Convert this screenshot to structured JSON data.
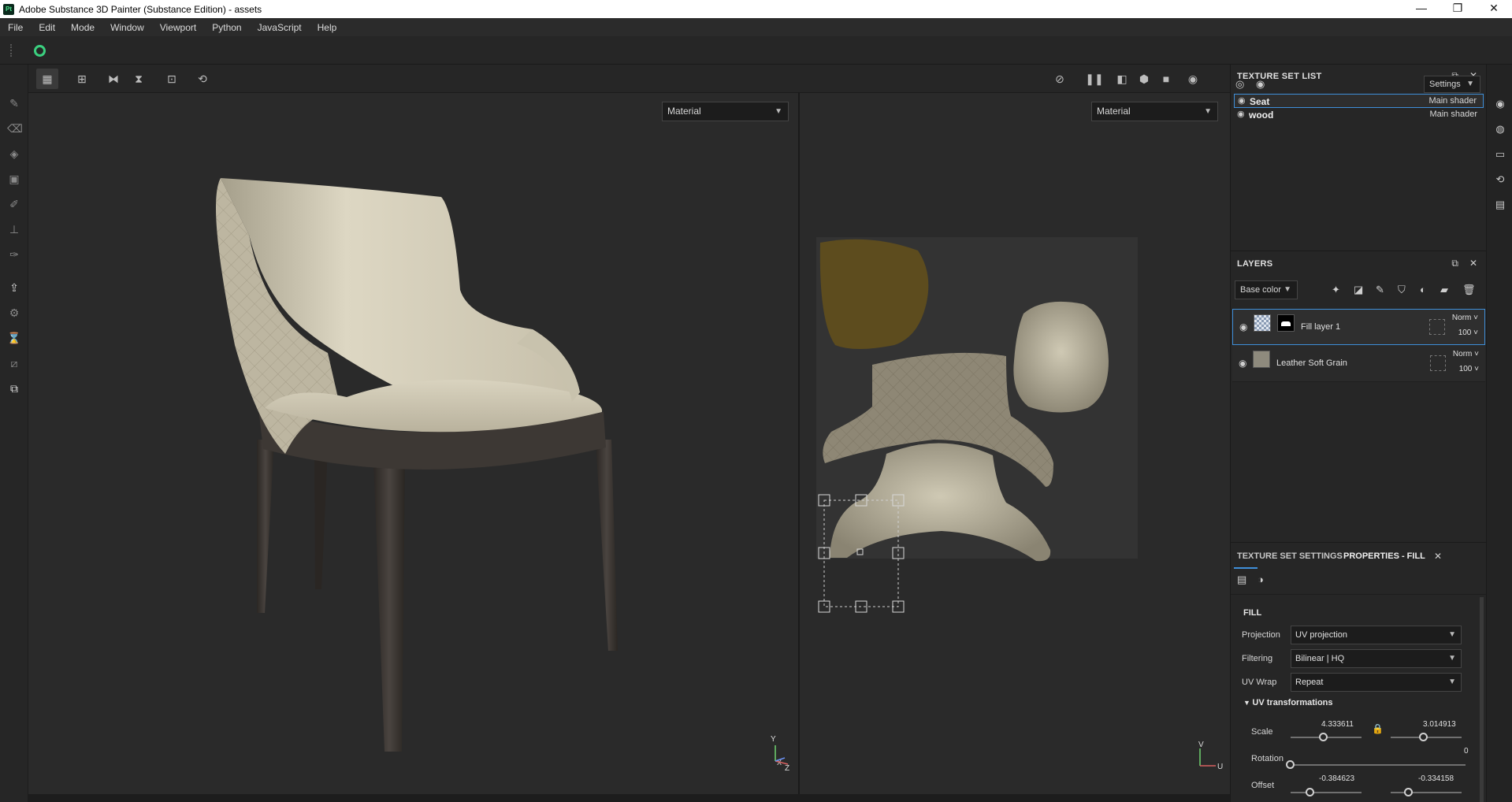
{
  "window": {
    "app_icon": "Pt",
    "title": "Adobe Substance 3D Painter (Substance Edition) - assets",
    "controls": [
      "—",
      "❐",
      "✕"
    ]
  },
  "menu": [
    "File",
    "Edit",
    "Mode",
    "Window",
    "Viewport",
    "Python",
    "JavaScript",
    "Help"
  ],
  "viewports": {
    "left_mode": "Material",
    "right_mode": "Material",
    "axis_3d": {
      "y": "Y",
      "x": "X",
      "z": "Z"
    },
    "axis_2d": {
      "v": "V",
      "u": "U"
    }
  },
  "texture_set_list": {
    "title": "TEXTURE SET LIST",
    "settings_label": "Settings",
    "sets": [
      {
        "name": "Seat",
        "shader": "Main shader",
        "selected": true
      },
      {
        "name": "wood",
        "shader": "Main shader",
        "selected": false
      }
    ]
  },
  "layers": {
    "title": "LAYERS",
    "channel": "Base color",
    "items": [
      {
        "name": "Fill layer 1",
        "blend": "Norm",
        "opacity": "100",
        "selected": true
      },
      {
        "name": "Leather Soft Grain",
        "blend": "Norm",
        "opacity": "100",
        "selected": false
      }
    ]
  },
  "properties": {
    "tab_inactive": "TEXTURE SET SETTINGS",
    "tab_active": "PROPERTIES - FILL",
    "section": "FILL",
    "projection_label": "Projection",
    "projection_value": "UV projection",
    "filtering_label": "Filtering",
    "filtering_value": "Bilinear | HQ",
    "uvwrap_label": "UV Wrap",
    "uvwrap_value": "Repeat",
    "uv_transform_title": "UV transformations",
    "scale_label": "Scale",
    "scale_u": "4.333611",
    "scale_v": "3.014913",
    "rotation_label": "Rotation",
    "rotation_value": "0",
    "offset_label": "Offset",
    "offset_u": "-0.384623",
    "offset_v": "-0.334158"
  },
  "colors": {
    "selection_blue": "#3f8fd9",
    "cloud_green": "#3bd07f"
  }
}
